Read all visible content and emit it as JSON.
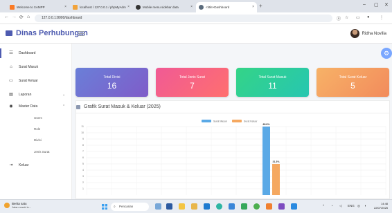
{
  "browser": {
    "tabs": [
      {
        "label": "Welcome to XAMPP",
        "color": "#fb7a24"
      },
      {
        "label": "localhost / 127.0.0.1 / phpMyAdm",
        "color": "#f2a33a"
      },
      {
        "label": "Mobile menu sidebar data",
        "color": "#333333"
      },
      {
        "label": "<title>Dashboard",
        "color": "#5b6b7c"
      }
    ],
    "new_tab": "+",
    "url": "127.0.0.1:8000/dashboard"
  },
  "header": {
    "brand": "Dinas Perhubungan",
    "user_name": "Ridha Novilia"
  },
  "sidebar": {
    "items": [
      {
        "label": "Dashboard",
        "icon": "dashboard-icon"
      },
      {
        "label": "Surat Masuk",
        "icon": "inbox-icon"
      },
      {
        "label": "Surat Keluar",
        "icon": "outbox-icon"
      },
      {
        "label": "Laporan",
        "icon": "report-icon",
        "chevron": "⌄"
      },
      {
        "label": "Master Data",
        "icon": "database-icon",
        "chevron": "⌃"
      },
      {
        "label": "Keluar",
        "icon": "logout-icon"
      }
    ],
    "sub_items": [
      "Users",
      "Role",
      "Divisi",
      "Jenis Surat"
    ]
  },
  "cards": [
    {
      "title": "Total Divisi",
      "value": "16"
    },
    {
      "title": "Total Jenis Surat",
      "value": "7"
    },
    {
      "title": "Total Surat Masuk",
      "value": "11"
    },
    {
      "title": "Total Surat Keluar",
      "value": "5"
    }
  ],
  "panel": {
    "title": "Grafik Surat Masuk & Keluar (2025)"
  },
  "chart_data": {
    "type": "bar",
    "ylim": [
      0,
      11
    ],
    "y_ticks": [
      "11",
      "10",
      "9",
      "8",
      "7",
      "6",
      "5",
      "4",
      "3",
      "2",
      "1"
    ],
    "series": [
      {
        "name": "Surat Masuk",
        "color": "#5aa9e6",
        "values": [
          11
        ],
        "label": "68.8%"
      },
      {
        "name": "Surat Keluar",
        "color": "#f5a860",
        "values": [
          5
        ],
        "label": "31.3%"
      }
    ]
  },
  "taskbar": {
    "weather_title": "Berita satu",
    "weather_sub": "Jalan rusak in...",
    "search_placeholder": "Pencarian",
    "tray_lang": "ENG",
    "clock_time": "14:48",
    "clock_date": "22/07/2025"
  }
}
